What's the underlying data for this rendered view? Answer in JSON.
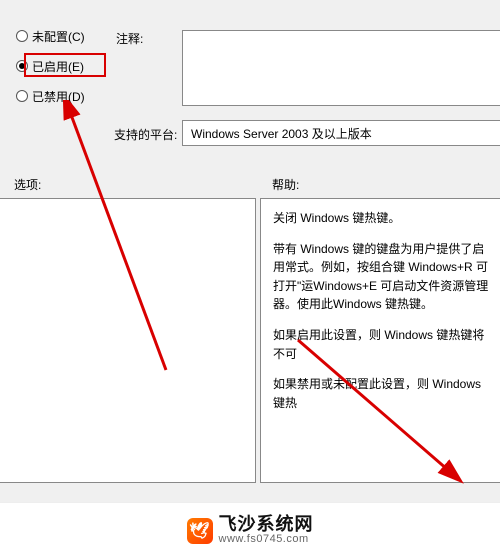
{
  "config": {
    "comment_label": "注释:",
    "platform_label": "支持的平台:",
    "platform_value": "Windows Server 2003 及以上版本",
    "radios": {
      "not_configured": "未配置(C)",
      "enabled": "已启用(E)",
      "disabled": "已禁用(D)"
    }
  },
  "sections": {
    "options_label": "选项:",
    "help_label": "帮助:"
  },
  "help": {
    "p1": "关闭 Windows 键热键。",
    "p2": "带有 Windows 键的键盘为用户提供了启用常式。例如，按组合键 Windows+R 可打开\"运Windows+E 可启动文件资源管理器。使用此Windows 键热键。",
    "p3": "如果启用此设置，则 Windows 键热键将不可",
    "p4": "如果禁用或未配置此设置，则 Windows 键热"
  },
  "watermark": {
    "brand": "飞沙系统网",
    "url": "www.fs0745.com",
    "logo_glyph": "🕊"
  }
}
